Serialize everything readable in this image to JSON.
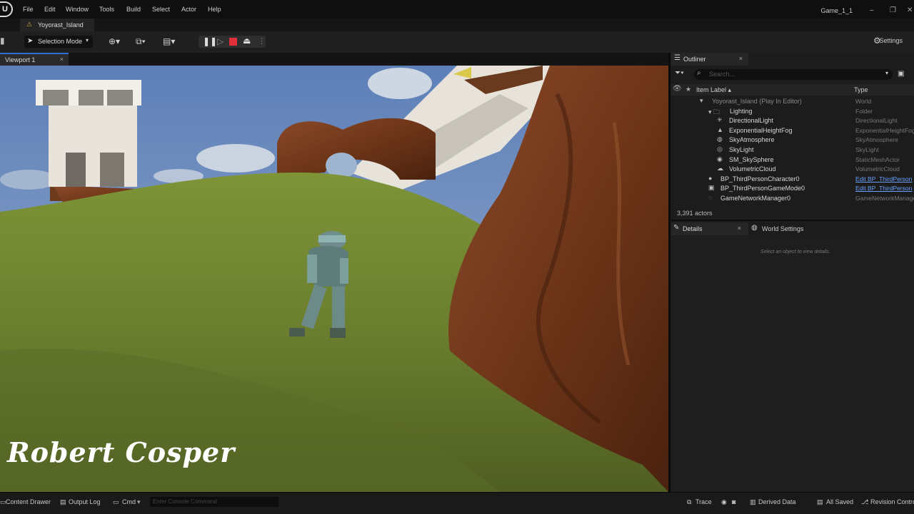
{
  "menubar": {
    "logo": "U",
    "items": [
      "File",
      "Edit",
      "Window",
      "Tools",
      "Build",
      "Select",
      "Actor",
      "Help"
    ],
    "window_title": "Game_1_1",
    "minimize": "–",
    "restore": "❐",
    "close": "✕"
  },
  "level_tab": {
    "label": "Yoyorast_Island",
    "icon": "level-icon"
  },
  "toolbar": {
    "selection_mode": "Selection Mode",
    "dropdown": "▾",
    "settings": "Settings",
    "icons": [
      "add-actor-icon",
      "blueprint-icon",
      "cinematics-icon",
      "pause-icon",
      "step-frame-icon",
      "stop-icon",
      "eject-icon",
      "more-options-icon"
    ]
  },
  "viewport_tab": {
    "label": "Viewport 1",
    "close": "×"
  },
  "watermark": "Robert Cosper",
  "outliner": {
    "tab_label": "Outliner",
    "close": "×",
    "search_placeholder": "Search...",
    "col_label": "Item Label ▴",
    "col_type": "Type",
    "rows": [
      {
        "label": "Yoyorast_Island (Play In Editor)",
        "type": "World",
        "indent": 0,
        "icon": "▾",
        "muted": true
      },
      {
        "label": "Lighting",
        "type": "Folder",
        "indent": 1,
        "icon": "▾ 🗀"
      },
      {
        "label": "DirectionalLight",
        "type": "DirectionalLight",
        "indent": 2,
        "icon": "✳"
      },
      {
        "label": "ExponentialHeightFog",
        "type": "ExponentialHeightFog",
        "indent": 2,
        "icon": "▲"
      },
      {
        "label": "SkyAtmosphere",
        "type": "SkyAtmosphere",
        "indent": 2,
        "icon": "◍"
      },
      {
        "label": "SkyLight",
        "type": "SkyLight",
        "indent": 2,
        "icon": "◎"
      },
      {
        "label": "SM_SkySphere",
        "type": "StaticMeshActor",
        "indent": 2,
        "icon": "◉"
      },
      {
        "label": "VolumetricCloud",
        "type": "VolumetricCloud",
        "indent": 2,
        "icon": "☁"
      },
      {
        "label": "BP_ThirdPersonCharacter0",
        "type": "Edit BP_ThirdPerson",
        "indent": 1,
        "icon": "●",
        "link": true
      },
      {
        "label": "BP_ThirdPersonGameMode0",
        "type": "Edit BP_ThirdPerson",
        "indent": 1,
        "icon": "▣",
        "link": true
      },
      {
        "label": "GameNetworkManager0",
        "type": "GameNetworkManager",
        "indent": 1,
        "icon": "◌"
      }
    ],
    "count": "3,391 actors"
  },
  "details": {
    "tab_label": "Details",
    "close": "×",
    "world_settings": "World Settings",
    "hint": "Select an object to view details."
  },
  "statusbar": {
    "content_drawer": "Content Drawer",
    "output_log": "Output Log",
    "cmd": "Cmd",
    "console_placeholder": "Enter Console Command",
    "trace": "Trace",
    "derived_data": "Derived Data",
    "all_saved": "All Saved",
    "revision_control": "Revision Control"
  }
}
